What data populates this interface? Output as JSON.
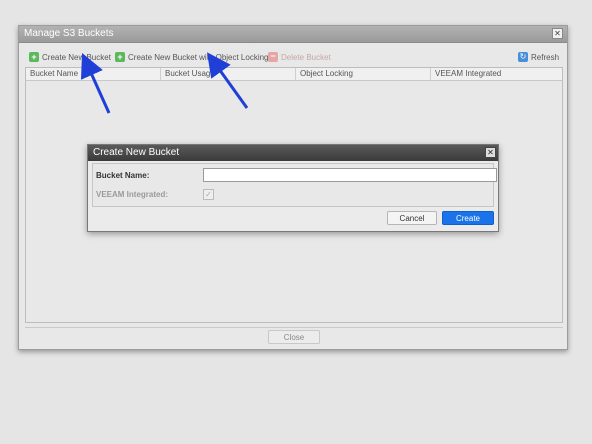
{
  "main_dialog": {
    "title": "Manage S3 Buckets",
    "close_icon": "close-icon"
  },
  "toolbar": {
    "create_bucket": "Create New Bucket",
    "create_bucket_locking": "Create New Bucket with Object Locking",
    "delete_bucket": "Delete Bucket",
    "refresh": "Refresh"
  },
  "grid": {
    "columns": [
      "Bucket Name",
      "Bucket Usage",
      "Object Locking",
      "VEEAM Integrated"
    ]
  },
  "footer": {
    "close_label": "Close"
  },
  "modal": {
    "title": "Create New Bucket",
    "bucket_name_label": "Bucket Name:",
    "bucket_name_value": "",
    "veeam_label": "VEEAM Integrated:",
    "veeam_checked": true,
    "cancel_label": "Cancel",
    "create_label": "Create"
  },
  "colors": {
    "create_button": "#1a73e8",
    "annotation_arrow": "#1f3fd6",
    "add_icon": "#5cb85c",
    "delete_icon": "#e6a6a6",
    "refresh_icon": "#4a90d9"
  }
}
